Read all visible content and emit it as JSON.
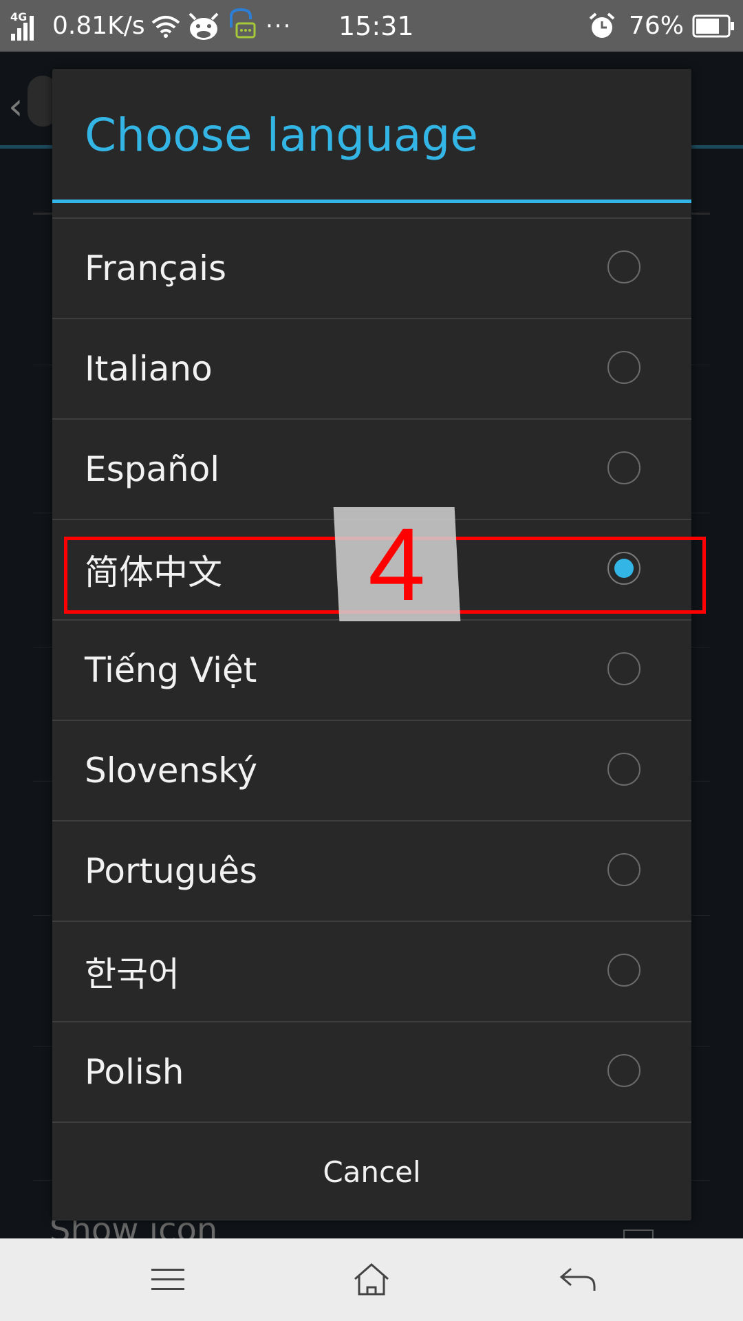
{
  "status_bar": {
    "network_type": "4G",
    "speed": "0.81K/s",
    "more": "···",
    "time": "15:31",
    "battery_percent": "76%",
    "battery_level": 0.76
  },
  "background": {
    "show_icon_label": "Show icon"
  },
  "dialog": {
    "title": "Choose language",
    "options": [
      {
        "label": "Français",
        "selected": false
      },
      {
        "label": "Italiano",
        "selected": false
      },
      {
        "label": "Español",
        "selected": false
      },
      {
        "label": "简体中文",
        "selected": true
      },
      {
        "label": "Tiếng Việt",
        "selected": false
      },
      {
        "label": "Slovenský",
        "selected": false
      },
      {
        "label": "Português",
        "selected": false
      },
      {
        "label": "한국어",
        "selected": false
      },
      {
        "label": "Polish",
        "selected": false
      }
    ],
    "cancel_label": "Cancel"
  },
  "annotation": {
    "step_number": "4",
    "highlight_color": "#ff0000"
  },
  "colors": {
    "accent": "#33b5e5",
    "dialog_bg": "#282828",
    "status_bar_bg": "#5e5e5e",
    "nav_bar_bg": "#ececec"
  }
}
